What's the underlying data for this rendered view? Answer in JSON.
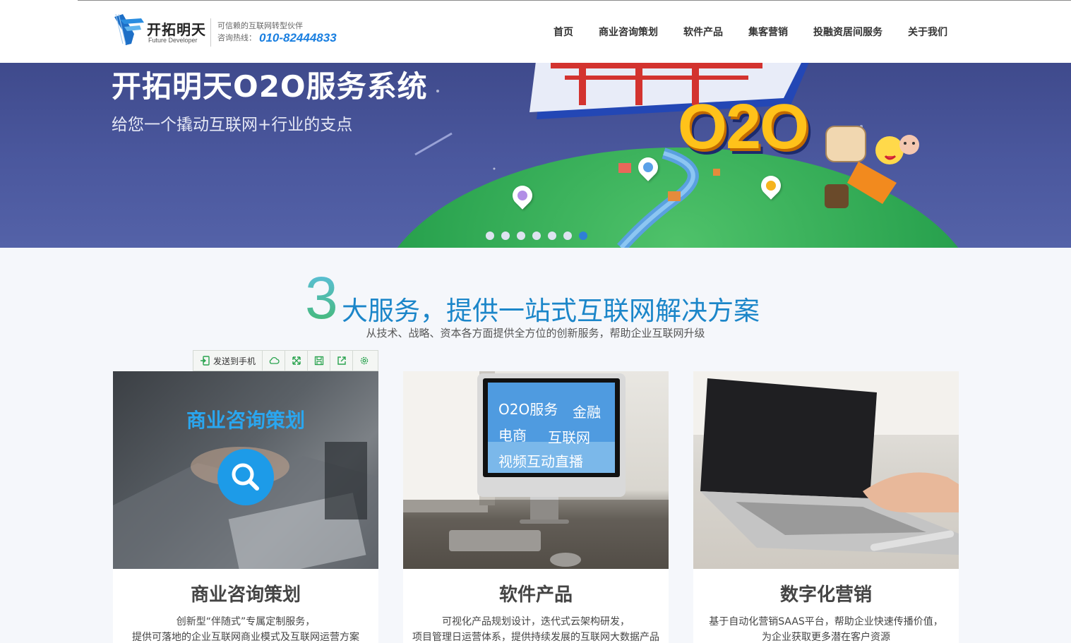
{
  "header": {
    "logo_cn": "开拓明天",
    "logo_en": "Future Developer",
    "tagline": "可信赖的互联网转型伙伴",
    "hotline_label": "咨询热线：",
    "hotline_number": "010-82444833",
    "nav": [
      "首页",
      "商业咨询策划",
      "软件产品",
      "集客营销",
      "投融资居间服务",
      "关于我们"
    ]
  },
  "banner": {
    "title": "开拓明天O2O服务系统",
    "subtitle": "给您一个撬动互联网+行业的支点",
    "o2o_text": "O2O",
    "slides_total": 7,
    "active_slide": 7
  },
  "services": {
    "number": "3",
    "title": "大服务，提供一站式互联网解决方案",
    "subtitle": "从技术、战略、资本各方面提供全方位的创新服务，帮助企业互联网升级"
  },
  "toolbar": {
    "send_label": "发送到手机",
    "icons": [
      "send-to-phone-icon",
      "cloud-icon",
      "fullscreen-icon",
      "save-icon",
      "share-icon",
      "settings-icon"
    ]
  },
  "cards": [
    {
      "image_label": "商业咨询策划",
      "title": "商业咨询策划",
      "desc1": "创新型“伴随式”专属定制服务，",
      "desc2": "提供可落地的企业互联网商业模式及互联网运营方案"
    },
    {
      "screen": [
        "O2O服务",
        "金融",
        "电商",
        "互联网",
        "视频互动直播"
      ],
      "title": "软件产品",
      "desc1": "可视化产品规划设计，迭代式云架构研发，",
      "desc2": "项目管理日运营体系，提供持续发展的互联网大数据产品"
    },
    {
      "title": "数字化营销",
      "desc1": "基于自动化营销SAAS平台，帮助企业快速传播价值，",
      "desc2": "为企业获取更多潜在客户资源"
    }
  ],
  "colors": {
    "accent": "#1c86c9",
    "hotline": "#1a7fe0",
    "banner_bg": "#4a579d",
    "toolbar_green": "#2aa34f"
  }
}
